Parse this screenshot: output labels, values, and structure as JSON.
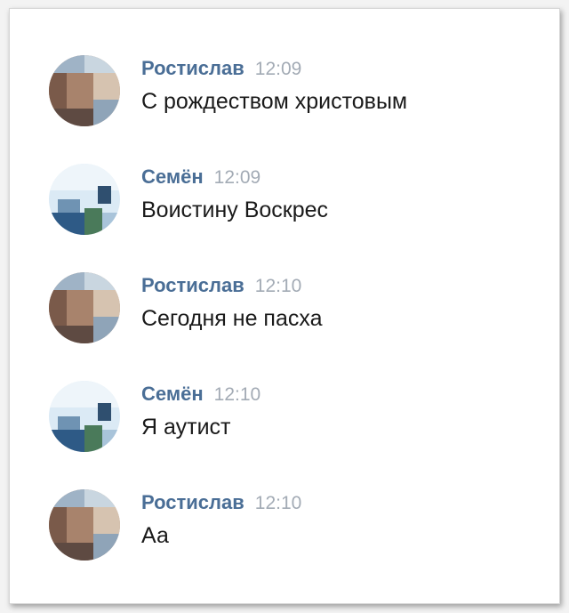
{
  "messages": [
    {
      "author": "Ростислав",
      "time": "12:09",
      "text": "С рождеством христовым",
      "avatar": "avatar-rostislav"
    },
    {
      "author": "Семён",
      "time": "12:09",
      "text": "Воистину Воскрес",
      "avatar": "avatar-semen"
    },
    {
      "author": "Ростислав",
      "time": "12:10",
      "text": "Сегодня не пасха",
      "avatar": "avatar-rostislav"
    },
    {
      "author": "Семён",
      "time": "12:10",
      "text": "Я аутист",
      "avatar": "avatar-semen"
    },
    {
      "author": "Ростислав",
      "time": "12:10",
      "text": "Аа",
      "avatar": "avatar-rostislav"
    }
  ],
  "colors": {
    "author": "#4a6e96",
    "time": "#a3abb5",
    "text": "#1a1a1a",
    "background": "#ffffff"
  }
}
